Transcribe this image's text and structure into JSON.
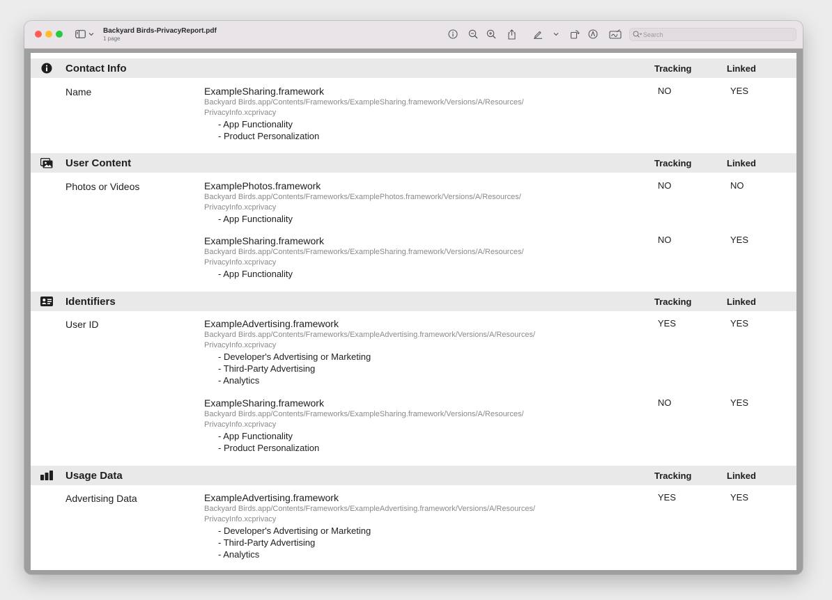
{
  "toolbar": {
    "title": "Backyard Birds-PrivacyReport.pdf",
    "subtitle": "1 page",
    "search_placeholder": "Search",
    "icons": [
      "sidebar-icon",
      "chevron-down-icon",
      "info-icon",
      "zoom-out-icon",
      "zoom-in-icon",
      "share-icon",
      "highlight-pen-icon",
      "chevron-down-icon",
      "rotate-icon",
      "markup-icon",
      "signature-icon",
      "search-icon"
    ]
  },
  "sections": [
    {
      "title": "Contact Info",
      "icon": "info-circle-icon",
      "tracking_label": "Tracking",
      "linked_label": "Linked",
      "rows": [
        {
          "data_type": "Name",
          "entries": [
            {
              "framework": "ExampleSharing.framework",
              "path_line1": "Backyard Birds.app/Contents/Frameworks/ExampleSharing.framework/Versions/A/Resources/",
              "path_line2": "PrivacyInfo.xcprivacy",
              "purposes": [
                "- App Functionality",
                "- Product Personalization"
              ],
              "tracking": "NO",
              "linked": "YES"
            }
          ]
        }
      ]
    },
    {
      "title": "User Content",
      "icon": "photos-icon",
      "tracking_label": "Tracking",
      "linked_label": "Linked",
      "rows": [
        {
          "data_type": "Photos or Videos",
          "entries": [
            {
              "framework": "ExamplePhotos.framework",
              "path_line1": "Backyard Birds.app/Contents/Frameworks/ExamplePhotos.framework/Versions/A/Resources/",
              "path_line2": "PrivacyInfo.xcprivacy",
              "purposes": [
                "- App Functionality"
              ],
              "tracking": "NO",
              "linked": "NO"
            },
            {
              "framework": "ExampleSharing.framework",
              "path_line1": "Backyard Birds.app/Contents/Frameworks/ExampleSharing.framework/Versions/A/Resources/",
              "path_line2": "PrivacyInfo.xcprivacy",
              "purposes": [
                "- App Functionality"
              ],
              "tracking": "NO",
              "linked": "YES"
            }
          ]
        }
      ]
    },
    {
      "title": "Identifiers",
      "icon": "id-card-icon",
      "tracking_label": "Tracking",
      "linked_label": "Linked",
      "rows": [
        {
          "data_type": "User ID",
          "entries": [
            {
              "framework": "ExampleAdvertising.framework",
              "path_line1": "Backyard Birds.app/Contents/Frameworks/ExampleAdvertising.framework/Versions/A/Resources/",
              "path_line2": "PrivacyInfo.xcprivacy",
              "purposes": [
                "- Developer's Advertising or Marketing",
                "- Third-Party Advertising",
                "- Analytics"
              ],
              "tracking": "YES",
              "linked": "YES"
            },
            {
              "framework": "ExampleSharing.framework",
              "path_line1": "Backyard Birds.app/Contents/Frameworks/ExampleSharing.framework/Versions/A/Resources/",
              "path_line2": "PrivacyInfo.xcprivacy",
              "purposes": [
                "- App Functionality",
                "- Product Personalization"
              ],
              "tracking": "NO",
              "linked": "YES"
            }
          ]
        }
      ]
    },
    {
      "title": "Usage Data",
      "icon": "bar-chart-icon",
      "tracking_label": "Tracking",
      "linked_label": "Linked",
      "rows": [
        {
          "data_type": "Advertising Data",
          "entries": [
            {
              "framework": "ExampleAdvertising.framework",
              "path_line1": "Backyard Birds.app/Contents/Frameworks/ExampleAdvertising.framework/Versions/A/Resources/",
              "path_line2": "PrivacyInfo.xcprivacy",
              "purposes": [
                "- Developer's Advertising or Marketing",
                "- Third-Party Advertising",
                "- Analytics"
              ],
              "tracking": "YES",
              "linked": "YES"
            }
          ]
        }
      ]
    }
  ]
}
